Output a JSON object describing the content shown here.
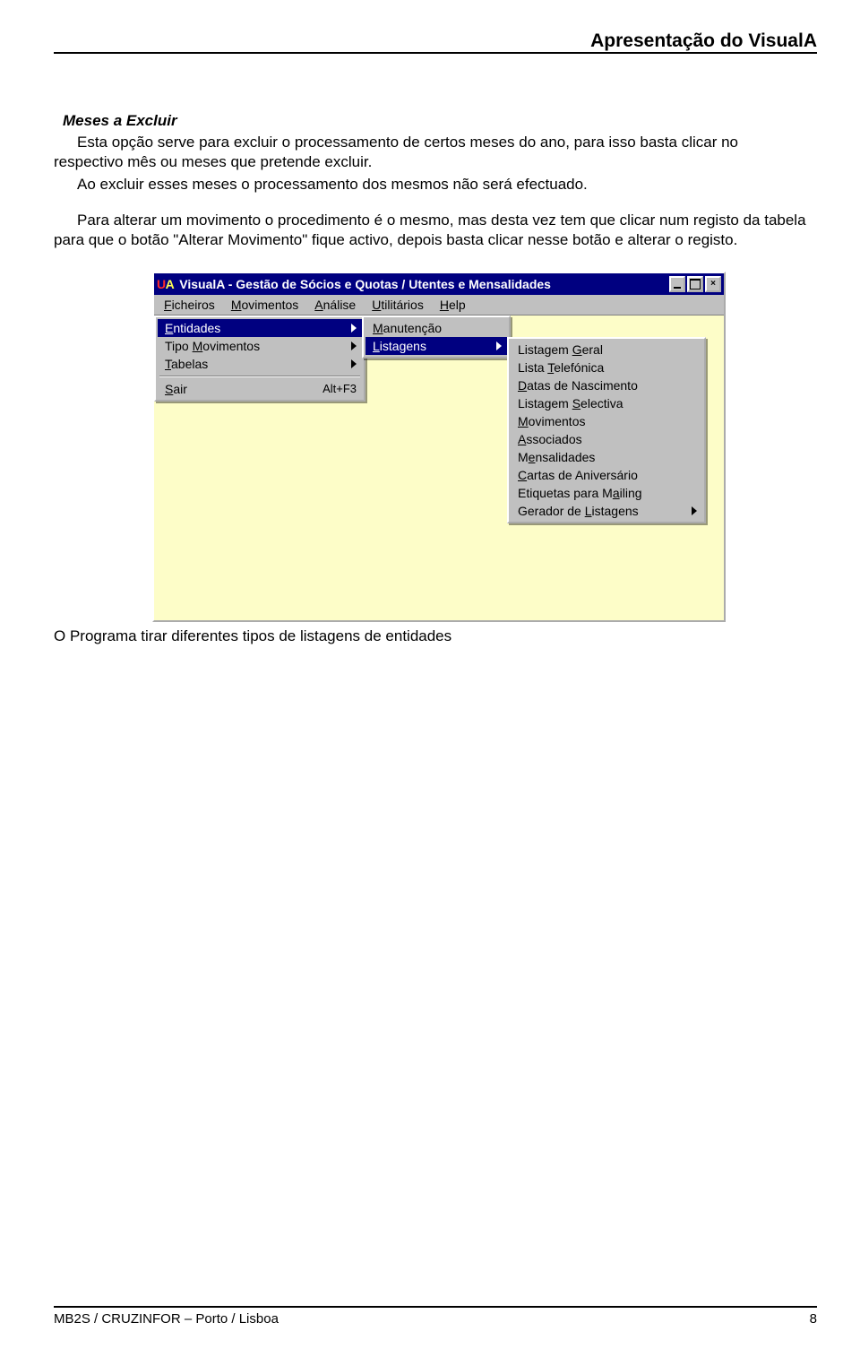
{
  "header": {
    "title": "Apresentação do VisualA"
  },
  "section": {
    "heading": "Meses a Excluir",
    "p1": "Esta opção serve para excluir o processamento de certos meses do ano, para isso basta clicar no respectivo mês ou meses que pretende excluir.",
    "p2": "Ao excluir esses meses o processamento dos mesmos não será efectuado.",
    "p3": "Para alterar um movimento o procedimento é o mesmo, mas desta vez tem que clicar num registo da tabela para que o botão \"Alterar Movimento\" fique activo, depois basta clicar nesse botão e alterar o registo."
  },
  "screenshot": {
    "app_mark_u": "U",
    "app_mark_a": "A",
    "title": "VisualA - Gestão de Sócios e Quotas / Utentes e Mensalidades",
    "controls": {
      "close_glyph": "×"
    },
    "menubar": [
      {
        "pre": "",
        "u": "F",
        "post": "icheiros"
      },
      {
        "pre": "",
        "u": "M",
        "post": "ovimentos"
      },
      {
        "pre": "",
        "u": "A",
        "post": "nálise"
      },
      {
        "pre": "",
        "u": "U",
        "post": "tilitários"
      },
      {
        "pre": "",
        "u": "H",
        "post": "elp"
      }
    ],
    "popup1": {
      "items": [
        {
          "pre": "",
          "u": "E",
          "post": "ntidades",
          "arrow": true,
          "hi": true
        },
        {
          "pre": "Tipo ",
          "u": "M",
          "post": "ovimentos",
          "arrow": true
        },
        {
          "pre": "",
          "u": "T",
          "post": "abelas",
          "arrow": true
        }
      ],
      "exit": {
        "pre": "",
        "u": "S",
        "post": "air",
        "shortcut": "Alt+F3"
      }
    },
    "popup2": {
      "items": [
        {
          "pre": "",
          "u": "M",
          "post": "anutenção"
        },
        {
          "pre": "",
          "u": "L",
          "post": "istagens",
          "arrow": true,
          "hi": true
        }
      ]
    },
    "popup3": {
      "items": [
        {
          "pre": "Listagem ",
          "u": "G",
          "post": "eral"
        },
        {
          "pre": "Lista ",
          "u": "T",
          "post": "elefónica"
        },
        {
          "pre": "",
          "u": "D",
          "post": "atas de Nascimento"
        },
        {
          "pre": "Listagem ",
          "u": "S",
          "post": "electiva"
        },
        {
          "pre": "",
          "u": "M",
          "post": "ovimentos"
        },
        {
          "pre": "",
          "u": "A",
          "post": "ssociados"
        },
        {
          "pre": "M",
          "u": "e",
          "post": "nsalidades"
        },
        {
          "pre": "",
          "u": "C",
          "post": "artas de Aniversário"
        },
        {
          "pre": "Etiquetas para M",
          "u": "a",
          "post": "iling"
        },
        {
          "pre": "Gerador de ",
          "u": "L",
          "post": "istagens",
          "arrow": true
        }
      ]
    }
  },
  "caption": "O Programa tirar diferentes tipos de listagens de entidades",
  "footer": {
    "left": "MB2S / CRUZINFOR – Porto / Lisboa",
    "page": "8"
  }
}
